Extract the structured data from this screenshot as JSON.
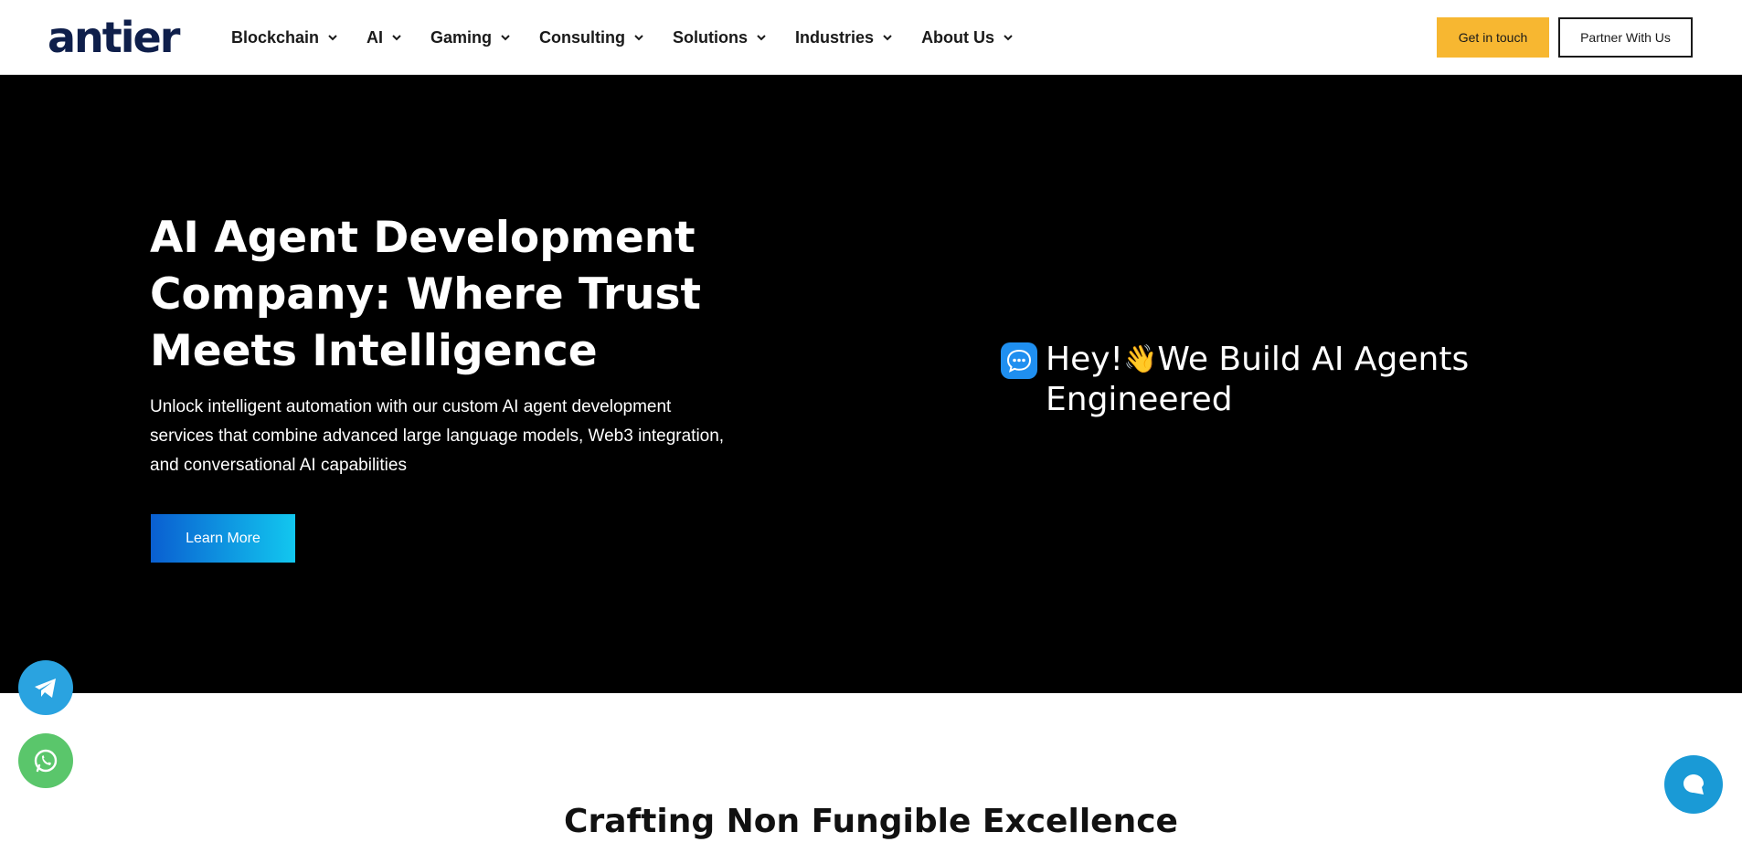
{
  "brand": {
    "logo_text": "antier"
  },
  "nav": {
    "items": [
      {
        "label": "Blockchain"
      },
      {
        "label": "AI"
      },
      {
        "label": "Gaming"
      },
      {
        "label": "Consulting"
      },
      {
        "label": "Solutions"
      },
      {
        "label": "Industries"
      },
      {
        "label": "About Us"
      }
    ]
  },
  "header": {
    "get_in_touch": "Get in touch",
    "partner": "Partner With Us"
  },
  "hero": {
    "title": "AI Agent Development Company: Where Trust Meets Intelligence",
    "description": "Unlock intelligent automation with our custom AI agent development services that combine advanced large language models, Web3 integration, and conversational AI capabilities",
    "cta": "Learn More",
    "typed_prefix": "Hey!",
    "typed_wave": "👋",
    "typed_rest": "We Build AI Agents Engineered"
  },
  "section": {
    "heading": "Crafting Non Fungible Excellence"
  },
  "colors": {
    "accent_yellow": "#f7b731",
    "hero_bg": "#000000",
    "cta_gradient_start": "#0a5fd1",
    "cta_gradient_end": "#12c7ef",
    "telegram": "#2aa3e0",
    "whatsapp": "#5ac66b",
    "chat": "#1a9ad6"
  },
  "icons": [
    "chevron-down-icon",
    "chat-bubble-icon",
    "telegram-icon",
    "whatsapp-icon",
    "chat-icon"
  ]
}
